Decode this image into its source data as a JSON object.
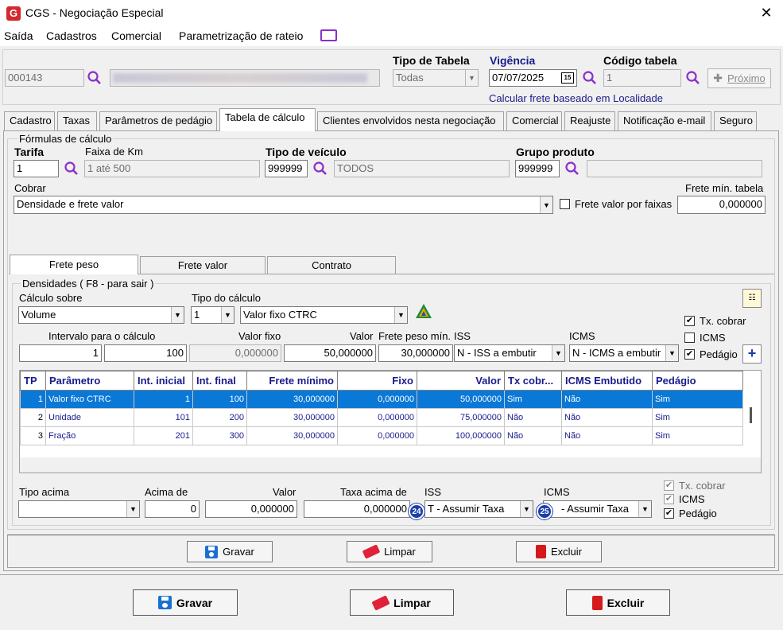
{
  "window": {
    "title": "CGS - Negociação Especial"
  },
  "menu": [
    "Saída",
    "Cadastros",
    "Comercial",
    "Parametrização de rateio"
  ],
  "header": {
    "code": "000143",
    "name_blur": "",
    "tipo_tabela_label": "Tipo de Tabela",
    "tipo_tabela_value": "Todas",
    "vigencia_label": "Vigência",
    "vigencia_value": "07/07/2025",
    "codigo_tabela_label": "Código tabela",
    "codigo_tabela_value": "1",
    "proximo_label": "Próximo",
    "calcular_link": "Calcular frete baseado em Localidade"
  },
  "tabs": [
    "Cadastro",
    "Taxas",
    "Parâmetros de pedágio",
    "Tabela de cálculo",
    "Clientes envolvidos nesta negociação",
    "Comercial",
    "Reajuste",
    "Notificação e-mail",
    "Seguro"
  ],
  "formulas": {
    "group_title": "Fórmulas de cálculo",
    "tarifa_label": "Tarifa",
    "tarifa_value": "1",
    "faixa_label": "Faixa de Km",
    "faixa_value": "1 até 500",
    "tipo_veiculo_label": "Tipo de veículo",
    "tipo_veiculo_code": "999999",
    "tipo_veiculo_desc": "TODOS",
    "grupo_label": "Grupo produto",
    "grupo_code": "999999",
    "grupo_desc": "",
    "cobrar_label": "Cobrar",
    "cobrar_value": "Densidade e frete valor",
    "frete_faixas_label": "Frete valor por faixas",
    "frete_min_label": "Frete mín. tabela",
    "frete_min_value": "0,000000"
  },
  "subtabs": [
    "Frete peso",
    "Frete valor",
    "Contrato"
  ],
  "densidades": {
    "title": "Densidades ( F8 - para sair )",
    "calculo_sobre_label": "Cálculo sobre",
    "calculo_sobre_value": "Volume",
    "tipo_calculo_label": "Tipo do cálculo",
    "tipo_calculo_num": "1",
    "tipo_calculo_value": "Valor fixo CTRC",
    "intervalo_label": "Intervalo para o cálculo",
    "intervalo_de": "1",
    "intervalo_ate": "100",
    "valor_fixo_label": "Valor fixo",
    "valor_fixo_value": "0,000000",
    "valor_label": "Valor",
    "valor_value": "50,000000",
    "frete_peso_min_label": "Frete peso mín.",
    "frete_peso_min_value": "30,000000",
    "iss_label": "ISS",
    "iss_value": "N - ISS a embutir",
    "icms_label": "ICMS",
    "icms_value": "N - ICMS a embutir",
    "tx_cobrar_label": "Tx. cobrar",
    "icms_chk_label": "ICMS",
    "pedagio_label": "Pedágio"
  },
  "grid": {
    "columns": [
      "TP",
      "Parâmetro",
      "Int. inicial",
      "Int. final",
      "Frete mínimo",
      "Fixo",
      "Valor",
      "Tx cobr...",
      "ICMS Embutido",
      "Pedágio"
    ],
    "rows": [
      [
        "1",
        "Valor fixo CTRC",
        "1",
        "100",
        "30,000000",
        "0,000000",
        "50,000000",
        "Sim",
        "Não",
        "Sim"
      ],
      [
        "2",
        "Unidade",
        "101",
        "200",
        "30,000000",
        "0,000000",
        "75,000000",
        "Não",
        "Não",
        "Sim"
      ],
      [
        "3",
        "Fração",
        "201",
        "300",
        "30,000000",
        "0,000000",
        "100,000000",
        "Não",
        "Não",
        "Sim"
      ]
    ]
  },
  "acima": {
    "tipo_acima_label": "Tipo acima",
    "tipo_acima_value": "",
    "acima_de_label": "Acima de",
    "acima_de_value": "0",
    "valor_label": "Valor",
    "valor_value": "0,000000",
    "taxa_label": "Taxa acima de",
    "taxa_value": "0,000000",
    "iss_label": "ISS",
    "iss_value": "T - Assumir Taxa",
    "icms_label": "ICMS",
    "icms_value": "- Assumir Taxa",
    "badge_iss": "24",
    "badge_icms": "25",
    "tx_cobrar_label": "Tx. cobrar",
    "icms_chk_label": "ICMS",
    "pedagio_label": "Pedágio"
  },
  "inner_buttons": {
    "gravar": "Gravar",
    "limpar": "Limpar",
    "excluir": "Excluir"
  },
  "outer_buttons": {
    "gravar": "Gravar",
    "limpar": "Limpar",
    "excluir": "Excluir"
  }
}
